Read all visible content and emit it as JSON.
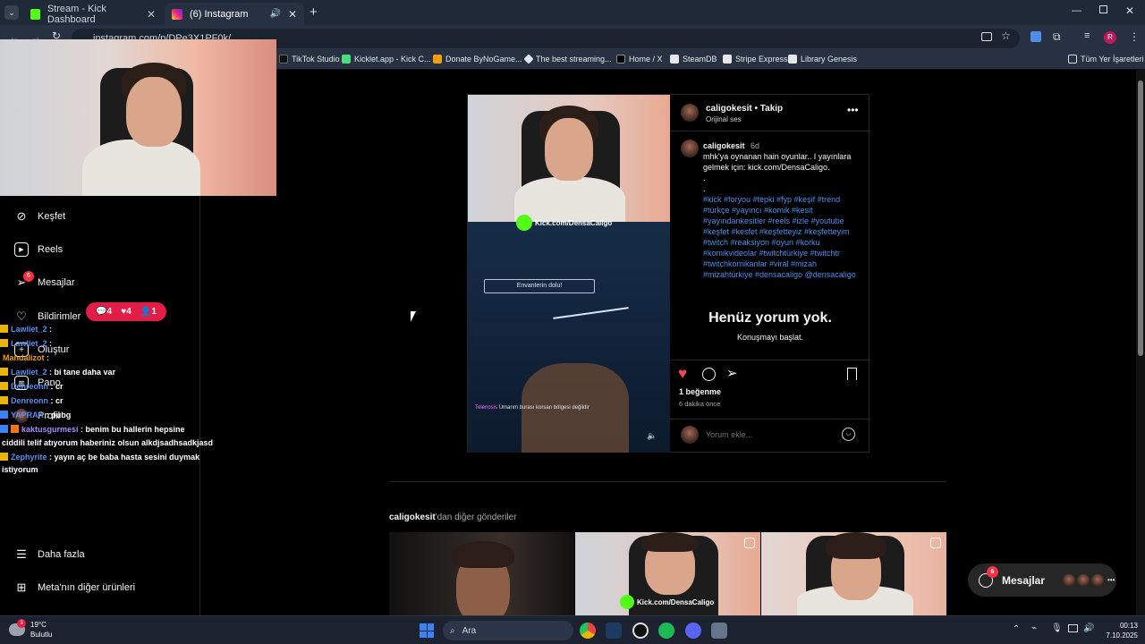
{
  "colors": {
    "accent": "#4f8ee8",
    "like": "#ed4956",
    "notify": "#e11d48",
    "kick_green": "#53fc18"
  },
  "tabs": [
    {
      "title": "Stream - Kick Dashboard",
      "favicon": "kick-icon"
    },
    {
      "title": "(6) Instagram",
      "favicon": "instagram-icon"
    }
  ],
  "url": "instagram.com/p/DPe3X1PF0k/",
  "bookmarks": [
    "TikTok Studio",
    "Kicklet.app - Kick C...",
    "Donate ByNoGame...",
    "The best streaming...",
    "Home / X",
    "SteamDB",
    "Stripe Express",
    "Library Genesis",
    "Tüm Yer İşaretleri"
  ],
  "sidebar": {
    "items": [
      {
        "label": "Keşfet",
        "icon": "compass-icon"
      },
      {
        "label": "Reels",
        "icon": "reels-icon"
      },
      {
        "label": "Mesajlar",
        "icon": "messenger-icon",
        "badge": "6"
      },
      {
        "label": "Bildirimler",
        "icon": "heart-icon"
      },
      {
        "label": "Oluştur",
        "icon": "plus-icon"
      },
      {
        "label": "Pano",
        "icon": "dashboard-icon"
      },
      {
        "label": "Profil",
        "icon": "profile-icon"
      }
    ],
    "more": "Daha fazla",
    "meta": "Meta'nın diğer ürünleri"
  },
  "notif_pill": {
    "comments": "4",
    "likes": "4",
    "follows": "1"
  },
  "chat": [
    {
      "user": "Lawliet_2",
      "text": ":"
    },
    {
      "user": "Lawliet_2",
      "text": ":"
    },
    {
      "user": "Mandalizot",
      "text": ":"
    },
    {
      "user": "Lawliet_2",
      "text": ": bi tane daha var"
    },
    {
      "user": "Denreonn",
      "text": ": cr"
    },
    {
      "user": "Denreonn",
      "text": ": cr"
    },
    {
      "user": "YAPRAK",
      "text": ": pubg"
    },
    {
      "user": "kaktusgurmesi",
      "text": ": benim bu hallerin hepsine"
    },
    {
      "user": "",
      "text": "ciddili telif atıyorum haberiniz olsun alkdjsadhsadkjasd"
    },
    {
      "user": "Zephyrite",
      "text": ": yayın aç be baba hasta sesini duymak"
    },
    {
      "user": "",
      "text": "istiyorum"
    }
  ],
  "post": {
    "username": "caligokesit",
    "follow": "Takip",
    "audio": "Orijinal ses",
    "age": "6d",
    "caption": "mhk'ya oynanan hain oyunlar.. I yayınlara gelmek için: kick.com/DensaCaligo.",
    "dots": ".\n.",
    "hashtags": "#kick #foryou #tepki #fyp #keşif #trend #türkçe #yayıncı #komik #kesit #yayındankesitler #reels #izle #youtube #keşfet #kesfet #keşfetteyiz #keşfetteyim #twitch #reaksiyon #oyun #korku #komikvideolar #twitchtürkiye #twitchtr #twitchkomikanlar #viral #mizah #mizahtürkiye #densacaligo @densacaligo",
    "no_comments": "Henüz yorum yok.",
    "start_conv": "Konuşmayı başlat.",
    "likes": "1 beğenme",
    "time": "6 dakika önce",
    "comment_placeholder": "Yorum ekle...",
    "media_overlay": "Kick.com/DensaCaligo",
    "game_box": "Envanterin dolu!",
    "game_sub_name": "Telenosis",
    "game_sub": "Umarım burası korsan bölgesi değildir"
  },
  "more_posts": {
    "user": "caligokesit",
    "suffix": "'dan diğer gönderiler"
  },
  "thumb_overlay": "Kick.com/DensaCaligo",
  "messages_pill": {
    "label": "Mesajlar",
    "badge": "6"
  },
  "taskbar": {
    "weather_temp": "19°C",
    "weather_desc": "Bulutlu",
    "weather_badge": "3",
    "search": "Ara",
    "time": "00:13",
    "date": "7.10.2025"
  }
}
